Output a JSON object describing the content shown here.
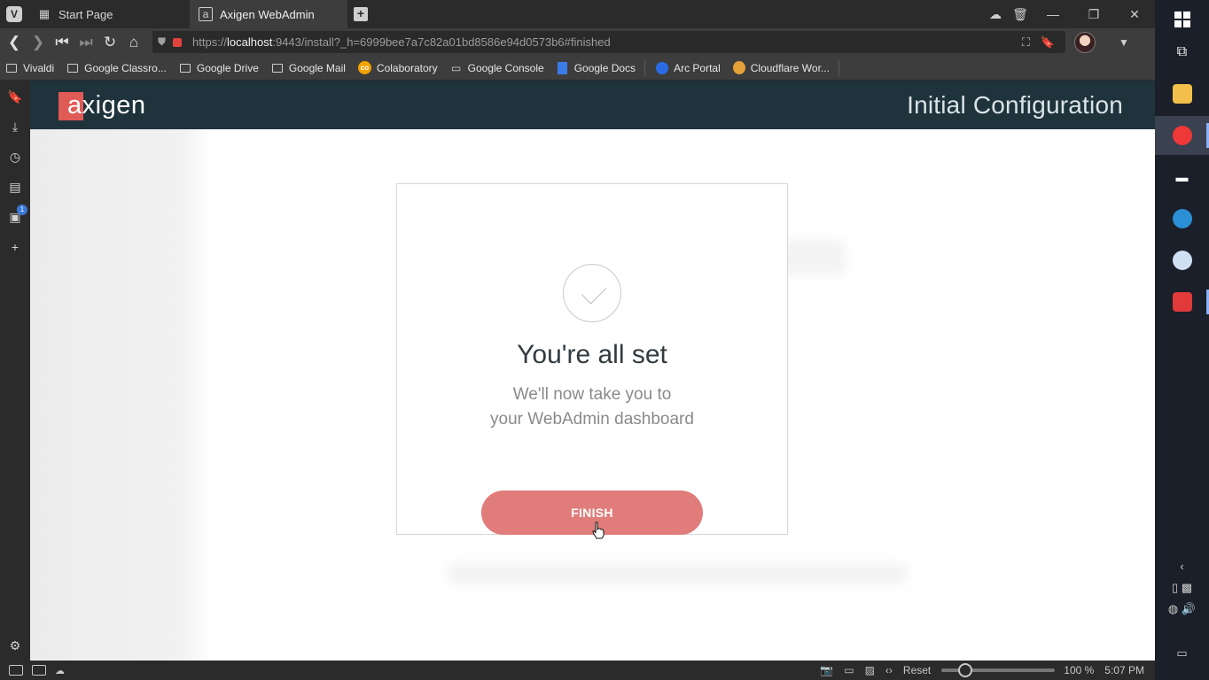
{
  "browser": {
    "tabs": [
      {
        "label": "Start Page",
        "icon": "grid-icon",
        "active": false
      },
      {
        "label": "Axigen WebAdmin",
        "icon": "axigen-favicon",
        "active": true
      }
    ],
    "address": {
      "prefix": "https://",
      "host": "localhost",
      "rest": ":9443/install?_h=6999bee7a7c82a01bd8586e94d0573b6#finished"
    },
    "bookmarks": [
      {
        "label": "Vivaldi",
        "icon": "folder-icon"
      },
      {
        "label": "Google Classro...",
        "icon": "folder-icon"
      },
      {
        "label": "Google Drive",
        "icon": "folder-icon"
      },
      {
        "label": "Google Mail",
        "icon": "folder-icon"
      },
      {
        "label": "Colaboratory",
        "icon": "colab-icon"
      },
      {
        "label": "Google Console",
        "icon": "console-icon"
      },
      {
        "label": "Google Docs",
        "icon": "docs-icon"
      },
      {
        "label": "Arc Portal",
        "icon": "arc-icon"
      },
      {
        "label": "Cloudflare Wor...",
        "icon": "cloudflare-icon"
      }
    ],
    "side_panel": {
      "notes_badge": "1"
    },
    "status": {
      "reset_label": "Reset",
      "zoom": "100 %",
      "clock": "5:07 PM",
      "zoom_level": 0.15
    }
  },
  "app": {
    "logo_first": "a",
    "logo_rest": "xigen",
    "header_title": "Initial Configuration",
    "card": {
      "title": "You're all set",
      "subtitle_line1": "We'll now take you to",
      "subtitle_line2": "your WebAdmin dashboard",
      "finish_label": "FINISH"
    }
  },
  "colors": {
    "header_bg": "#1f333c",
    "brand_red": "#e05a56",
    "finish_button": "#e07c7a"
  }
}
